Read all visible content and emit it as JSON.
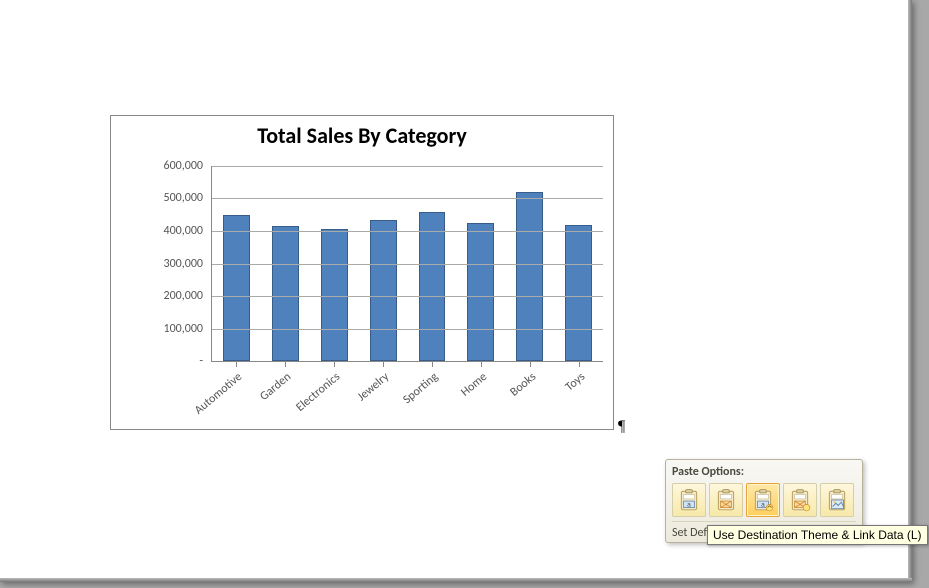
{
  "chart_data": {
    "type": "bar",
    "title": "Total Sales By Category",
    "categories": [
      "Automotive",
      "Garden",
      "Electronics",
      "Jewelry",
      "Sporting",
      "Home",
      "Books",
      "Toys"
    ],
    "values": [
      450000,
      415000,
      405000,
      435000,
      460000,
      425000,
      520000,
      420000
    ],
    "ylim": [
      0,
      600000
    ],
    "y_ticks": [
      "-",
      "100,000",
      "200,000",
      "300,000",
      "400,000",
      "500,000",
      "600,000"
    ],
    "xlabel": "",
    "ylabel": ""
  },
  "paragraph_mark": "¶",
  "paste_options": {
    "title": "Paste Options:",
    "set_default": "Set Default Paste...",
    "icons": [
      {
        "name": "use-destination-theme-embed",
        "selected": false
      },
      {
        "name": "keep-source-formatting-embed",
        "selected": false
      },
      {
        "name": "use-destination-theme-link",
        "selected": true
      },
      {
        "name": "keep-source-formatting-link",
        "selected": false
      },
      {
        "name": "picture",
        "selected": false
      }
    ]
  },
  "tooltip": "Use Destination Theme & Link Data (L)"
}
